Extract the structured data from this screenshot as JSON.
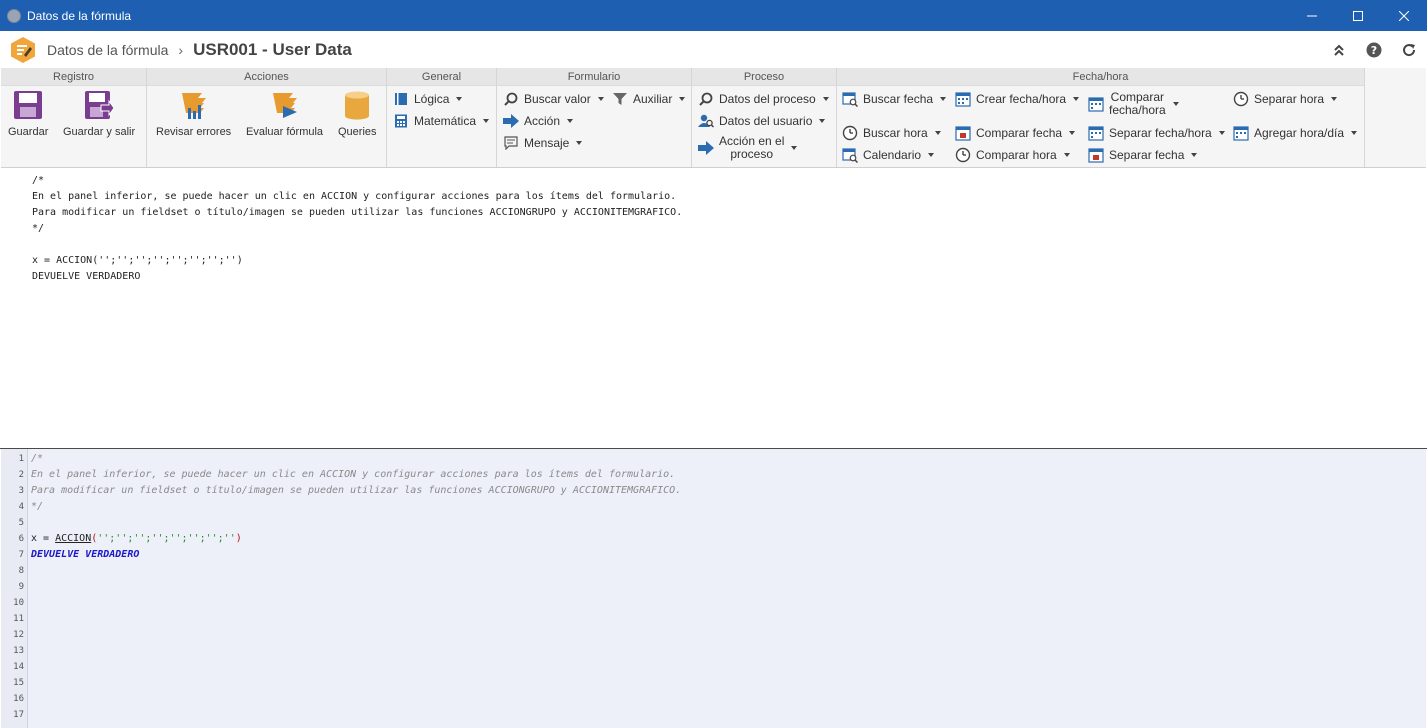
{
  "window": {
    "title": "Datos de la fórmula"
  },
  "header": {
    "breadcrumb_parent": "Datos de la fórmula",
    "breadcrumb_current": "USR001 - User Data"
  },
  "colors": {
    "titlebar": "#1e5fb1",
    "ribbon_bg": "#f5f5f5",
    "group_title_bg": "#e6e6e6",
    "editor_bg": "#edf0f9",
    "icon_blue": "#2b6cb0",
    "icon_purple": "#7a3d8f",
    "icon_orange": "#e79b2e",
    "keyword": "#1a1ac8"
  },
  "ribbon": {
    "registro": {
      "title": "Registro",
      "guardar": "Guardar",
      "guardar_salir": "Guardar y salir"
    },
    "acciones": {
      "title": "Acciones",
      "revisar": "Revisar errores",
      "evaluar": "Evaluar fórmula",
      "queries": "Queries"
    },
    "general": {
      "title": "General",
      "logica": "Lógica",
      "matematica": "Matemática"
    },
    "formulario": {
      "title": "Formulario",
      "buscar_valor": "Buscar valor",
      "auxiliar": "Auxiliar",
      "accion": "Acción",
      "mensaje": "Mensaje"
    },
    "proceso": {
      "title": "Proceso",
      "datos_proceso": "Datos del proceso",
      "datos_usuario": "Datos del usuario",
      "accion_proceso_l1": "Acción en el",
      "accion_proceso_l2": "proceso"
    },
    "fechahora": {
      "title": "Fecha/hora",
      "buscar_fecha": "Buscar fecha",
      "crear_fecha_hora": "Crear fecha/hora",
      "comparar_fecha_hora_l1": "Comparar",
      "comparar_fecha_hora_l2": "fecha/hora",
      "separar_hora": "Separar hora",
      "buscar_hora": "Buscar hora",
      "comparar_fecha": "Comparar fecha",
      "separar_fecha_hora": "Separar fecha/hora",
      "agregar_hora_dia": "Agregar hora/día",
      "calendario": "Calendario",
      "comparar_hora": "Comparar hora",
      "separar_fecha": "Separar fecha"
    }
  },
  "preview": {
    "lines": [
      "/*",
      "En el panel inferior, se puede hacer un clic en ACCION y configurar acciones para los ítems del formulario.",
      "Para modificar un fieldset o título/imagen se pueden utilizar las funciones ACCIONGRUPO y ACCIONITEMGRAFICO.",
      "*/",
      "",
      "x = ACCION('';'';'';'';'';'';'';'')",
      "DEVUELVE VERDADERO"
    ]
  },
  "editor": {
    "line_numbers": [
      "1",
      "2",
      "3",
      "4",
      "5",
      "6",
      "7",
      "8",
      "9",
      "10",
      "11",
      "12",
      "13",
      "14",
      "15",
      "16",
      "17"
    ],
    "comment_lines": [
      "/*",
      "En el panel inferior, se puede hacer un clic en ACCION y configurar acciones para los ítems del formulario.",
      "Para modificar un fieldset o título/imagen se pueden utilizar las funciones ACCIONGRUPO y ACCIONITEMGRAFICO.",
      "*/"
    ],
    "assign_prefix": "x = ",
    "function_name": "ACCION",
    "paren_open": "(",
    "args": "'';'';'';'';'';'';'';''",
    "paren_close": ")",
    "return_stmt": "DEVUELVE VERDADERO"
  }
}
